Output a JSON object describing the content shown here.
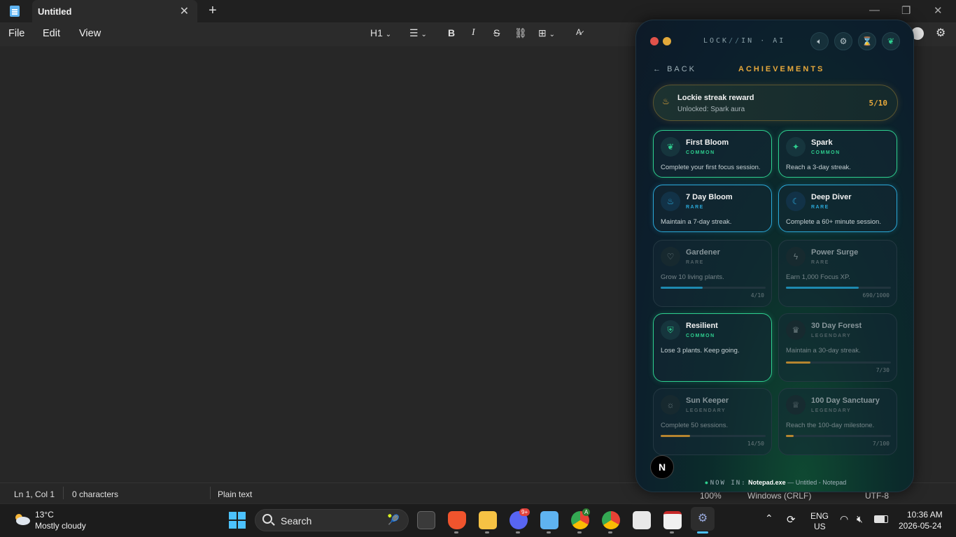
{
  "notepad": {
    "tab_title": "Untitled",
    "menus": [
      "File",
      "Edit",
      "View"
    ],
    "heading_label": "H1",
    "status": {
      "position": "Ln 1, Col 1",
      "chars": "0 characters",
      "format": "Plain text",
      "zoom": "100%",
      "line_ending": "Windows (CRLF)",
      "encoding": "UTF-8"
    }
  },
  "taskbar": {
    "weather_temp": "13°C",
    "weather_desc": "Mostly cloudy",
    "search_placeholder": "Search",
    "discord_badge": "9+",
    "chrome_badge": "A",
    "lang": "ENG",
    "region": "US",
    "time": "10:36 AM",
    "date": "2026-05-24"
  },
  "lockin": {
    "brand_left": "LOCK",
    "brand_slash": "//",
    "brand_right": "IN · AI",
    "back_label": "BACK",
    "title": "ACHIEVEMENTS",
    "streak": {
      "title": "Lockie streak reward",
      "subtitle": "Unlocked: Spark aura",
      "count": "5/10"
    },
    "achievements": [
      {
        "name": "First Bloom",
        "rarity": "COMMON",
        "desc": "Complete your first focus session.",
        "icon": "leaf-icon"
      },
      {
        "name": "Spark",
        "rarity": "COMMON",
        "desc": "Reach a 3-day streak.",
        "icon": "sparkle-icon"
      },
      {
        "name": "7 Day Bloom",
        "rarity": "RARE",
        "desc": "Maintain a 7-day streak.",
        "icon": "flame-icon"
      },
      {
        "name": "Deep Diver",
        "rarity": "RARE",
        "desc": "Complete a 60+ minute session.",
        "icon": "moon-icon"
      },
      {
        "name": "Gardener",
        "rarity": "RARE",
        "desc": "Grow 10 living plants.",
        "progress": "4/10",
        "fraction": 0.4,
        "icon": "heart-icon"
      },
      {
        "name": "Power Surge",
        "rarity": "RARE",
        "desc": "Earn 1,000 Focus XP.",
        "progress": "690/1000",
        "fraction": 0.69,
        "icon": "bolt-icon"
      },
      {
        "name": "Resilient",
        "rarity": "COMMON",
        "desc": "Lose 3 plants. Keep going.",
        "icon": "shield-icon"
      },
      {
        "name": "30 Day Forest",
        "rarity": "LEGENDARY",
        "desc": "Maintain a 30-day streak.",
        "progress": "7/30",
        "fraction": 0.233,
        "icon": "crown-icon"
      },
      {
        "name": "Sun Keeper",
        "rarity": "LEGENDARY",
        "desc": "Complete 50 sessions.",
        "progress": "14/50",
        "fraction": 0.28,
        "icon": "sun-icon"
      },
      {
        "name": "100 Day Sanctuary",
        "rarity": "LEGENDARY",
        "desc": "Reach the 100-day milestone.",
        "progress": "7/100",
        "fraction": 0.07,
        "icon": "trophy-icon"
      }
    ],
    "now_in_label": "NOW IN:",
    "now_in_app": "Notepad.exe",
    "now_in_detail": "— Untitled - Notepad",
    "badge": "N"
  },
  "colors": {
    "accent_gold": "#e8a93c",
    "common": "#2ecf8f",
    "rare": "#2aa8d8",
    "legendary": "#c08a30"
  }
}
